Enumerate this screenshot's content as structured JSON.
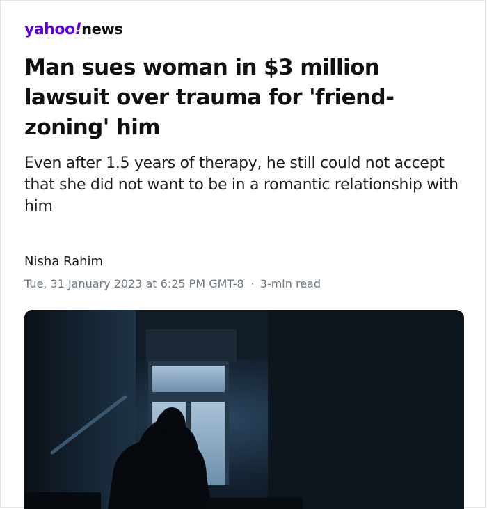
{
  "brand": {
    "logo_yahoo": "yahoo",
    "logo_bang": "!",
    "logo_news": "news",
    "accent_color": "#6001d2"
  },
  "article": {
    "headline": "Man sues woman in $3 million lawsuit over trauma for 'friend-zoning' him",
    "subheadline": "Even after 1.5 years of therapy, he still could not accept that she did not want to be in a romantic relationship with him",
    "author": "Nisha Rahim",
    "published": "Tue, 31 January 2023 at 6:25 PM GMT-8",
    "separator": "·",
    "read_time": "3-min read"
  },
  "hero_image": {
    "subject": "silhouette of person sitting on stairs beneath window"
  }
}
